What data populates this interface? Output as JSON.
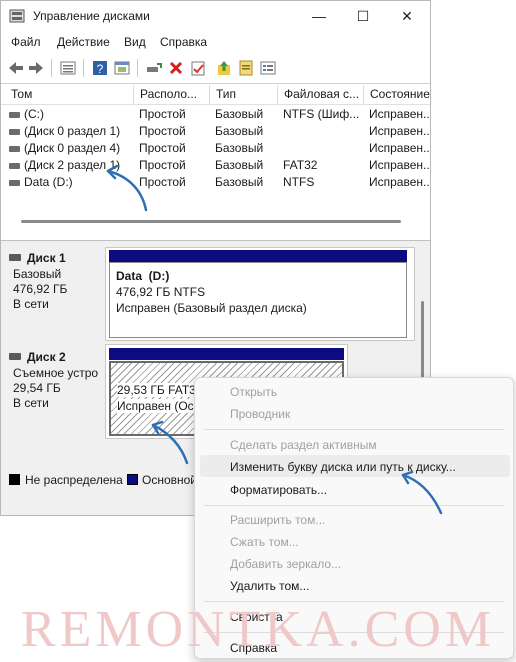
{
  "window": {
    "title": "Управление дисками",
    "minimize_glyph": "—",
    "maximize_glyph": "☐",
    "close_glyph": "✕"
  },
  "menu": [
    "Файл",
    "Действие",
    "Вид",
    "Справка"
  ],
  "volume_list": {
    "columns": [
      "Том",
      "Располо...",
      "Тип",
      "Файловая с...",
      "Состояние"
    ],
    "rows": [
      [
        "(C:)",
        "Простой",
        "Базовый",
        "NTFS (Шиф...",
        "Исправен..."
      ],
      [
        "(Диск 0 раздел 1)",
        "Простой",
        "Базовый",
        "",
        "Исправен..."
      ],
      [
        "(Диск 0 раздел 4)",
        "Простой",
        "Базовый",
        "",
        "Исправен..."
      ],
      [
        "(Диск 2 раздел 1)",
        "Простой",
        "Базовый",
        "FAT32",
        "Исправен..."
      ],
      [
        "Data (D:)",
        "Простой",
        "Базовый",
        "NTFS",
        "Исправен..."
      ]
    ]
  },
  "disks": [
    {
      "name": "Диск 1",
      "type": "Базовый",
      "size": "476,92 ГБ",
      "status": "В сети",
      "partition": {
        "title": "Data  (D:)",
        "size_fs": "476,92 ГБ NTFS",
        "status": "Исправен (Базовый раздел диска)"
      }
    },
    {
      "name": "Диск 2",
      "type": "Съемное устро",
      "size": "29,54 ГБ",
      "status": "В сети",
      "partition": {
        "size_fs": "29,53 ГБ FAT32",
        "status": "Исправен (Осн"
      }
    }
  ],
  "legend": {
    "unallocated": "Не распределена",
    "primary": "Основной"
  },
  "context_menu": {
    "open": "Открыть",
    "explorer": "Проводник",
    "mark_active": "Сделать раздел активным",
    "change_letter": "Изменить букву диска или путь к диску...",
    "format": "Форматировать...",
    "extend": "Расширить том...",
    "shrink": "Сжать том...",
    "add_mirror": "Добавить зеркало...",
    "delete": "Удалить том...",
    "properties": "Свойства",
    "help": "Справка"
  },
  "watermark": "REMONTKA.COM",
  "colors": {
    "partition_bar": "#0c0c80",
    "arrow": "#2e6fb5",
    "watermark": "#f0c8c8"
  }
}
